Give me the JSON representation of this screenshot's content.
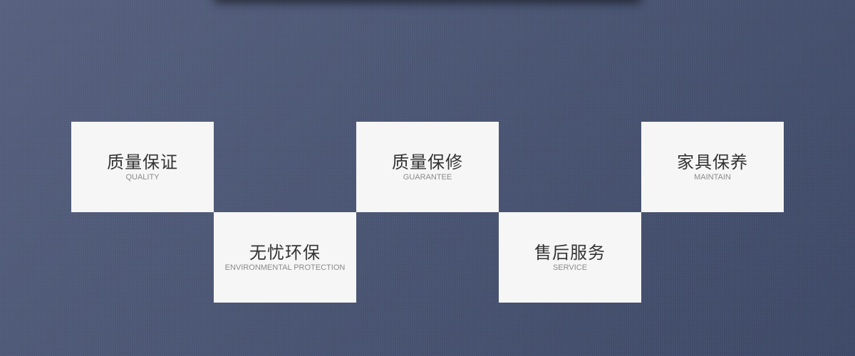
{
  "features": [
    {
      "title": "质量保证",
      "subtitle": "QUALITY"
    },
    {
      "title": "无忧环保",
      "subtitle": "ENVIRONMENTAL PROTECTION"
    },
    {
      "title": "质量保修",
      "subtitle": "GUARANTEE"
    },
    {
      "title": "售后服务",
      "subtitle": "SERVICE"
    },
    {
      "title": "家具保养",
      "subtitle": "MAINTAIN"
    }
  ],
  "colors": {
    "background": "#4a5572",
    "tile": "#f6f6f6",
    "title_text": "#333333",
    "subtitle_text": "#8a8a8a"
  }
}
